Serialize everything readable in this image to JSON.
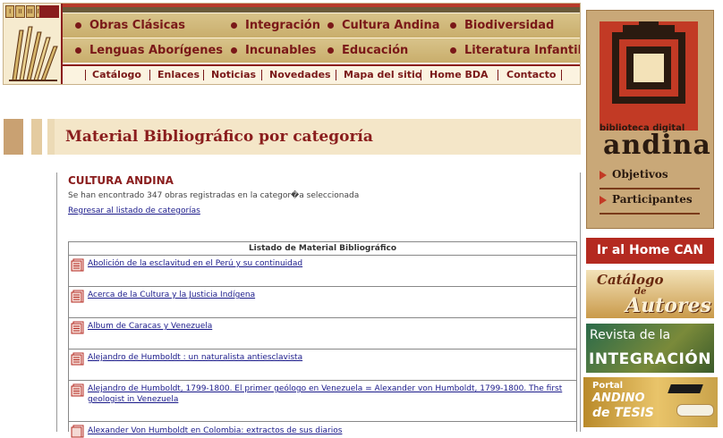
{
  "header": {
    "logo_books": [
      "I",
      "II",
      "III",
      "IV"
    ],
    "categories_row1": [
      "Obras Clásicas",
      "Integración",
      "Cultura Andina",
      "Biodiversidad"
    ],
    "categories_row2": [
      "Lenguas Aborígenes",
      "Incunables",
      "Educación",
      "Literatura Infantil"
    ],
    "nav": [
      "Catálogo",
      "Enlaces",
      "Noticias",
      "Novedades",
      "Mapa del sitio",
      "Home BDA",
      "Contacto"
    ]
  },
  "page": {
    "title": "Material Bibliográfico por categoría",
    "section": "CULTURA ANDINA",
    "found_text": "Se han encontrado 347 obras registradas en la categor�a seleccionada",
    "back_link": "Regresar al listado de categorías"
  },
  "table": {
    "header": "Listado de Material Bibliográfico",
    "rows": [
      "Abolición de la esclavitud en el Perú y su continuidad",
      "Acerca de la Cultura y la Justicia Indígena",
      "Album de Caracas y Venezuela",
      "Alejandro de Humboldt : un naturalista antiesclavista",
      "Alejandro de Humboldt, 1799-1800. El primer geólogo en Venezuela = Alexander von Humboldt, 1799-1800. The first geologist in Venezuela",
      "Alexander Von Humboldt en Colombia: extractos de sus diarios"
    ]
  },
  "sidebar": {
    "bda_line1": "biblioteca digital",
    "bda_line2": "andina",
    "bda_buttons": [
      "Objetivos",
      "Participantes"
    ],
    "can_button": "Ir al Home CAN",
    "catalogo_t1": "Catálogo",
    "catalogo_t2": "de",
    "catalogo_t3": "Autores",
    "revista_t1": "Revista de la",
    "revista_t2": "INTEGRACIÓN",
    "tesis_t1": "Portal",
    "tesis_t2": "ANDINO",
    "tesis_t3": "de TESIS"
  },
  "colors": {
    "brand_red": "#8a1d1d",
    "link_blue": "#1a1a8a",
    "band_beige": "#f4e6c8"
  },
  "icons": {
    "logo": "bookshelf-logo-icon",
    "row": "document-icon",
    "bullet": "bullet-dot-icon",
    "arrow": "triangle-arrow-icon"
  }
}
